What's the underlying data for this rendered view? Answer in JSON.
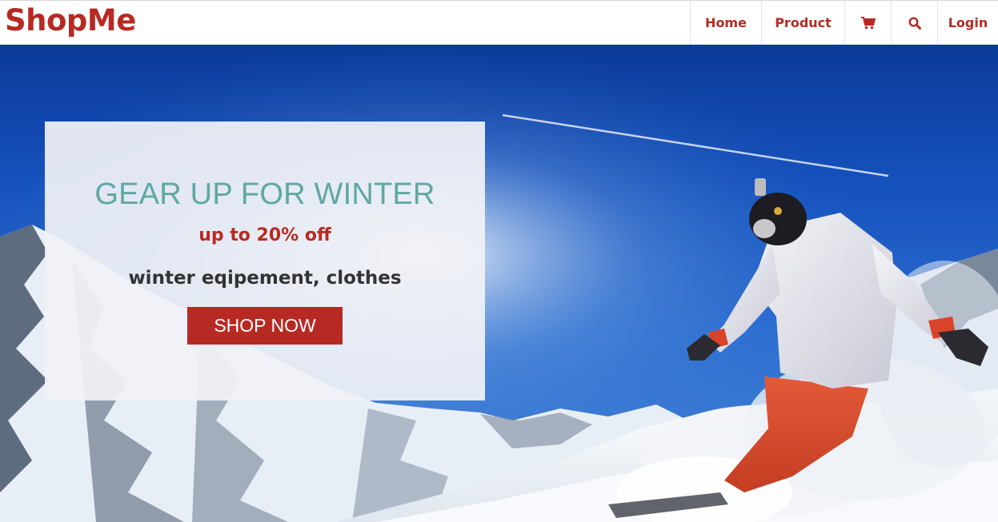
{
  "brand": {
    "name": "ShopMe",
    "color": "#b72a23"
  },
  "nav": {
    "home_label": "Home",
    "product_label": "Product",
    "cart_icon": "shopping-cart-icon",
    "search_icon": "search-icon",
    "login_label": "Login"
  },
  "hero": {
    "title": "GEAR UP FOR WINTER",
    "discount": "up to 20% off",
    "subtitle": "winter eqipement, clothes",
    "cta_label": "SHOP NOW"
  },
  "colors": {
    "accent": "#b72a23",
    "title_teal": "#5fa8a3",
    "text_dark": "#333333"
  }
}
